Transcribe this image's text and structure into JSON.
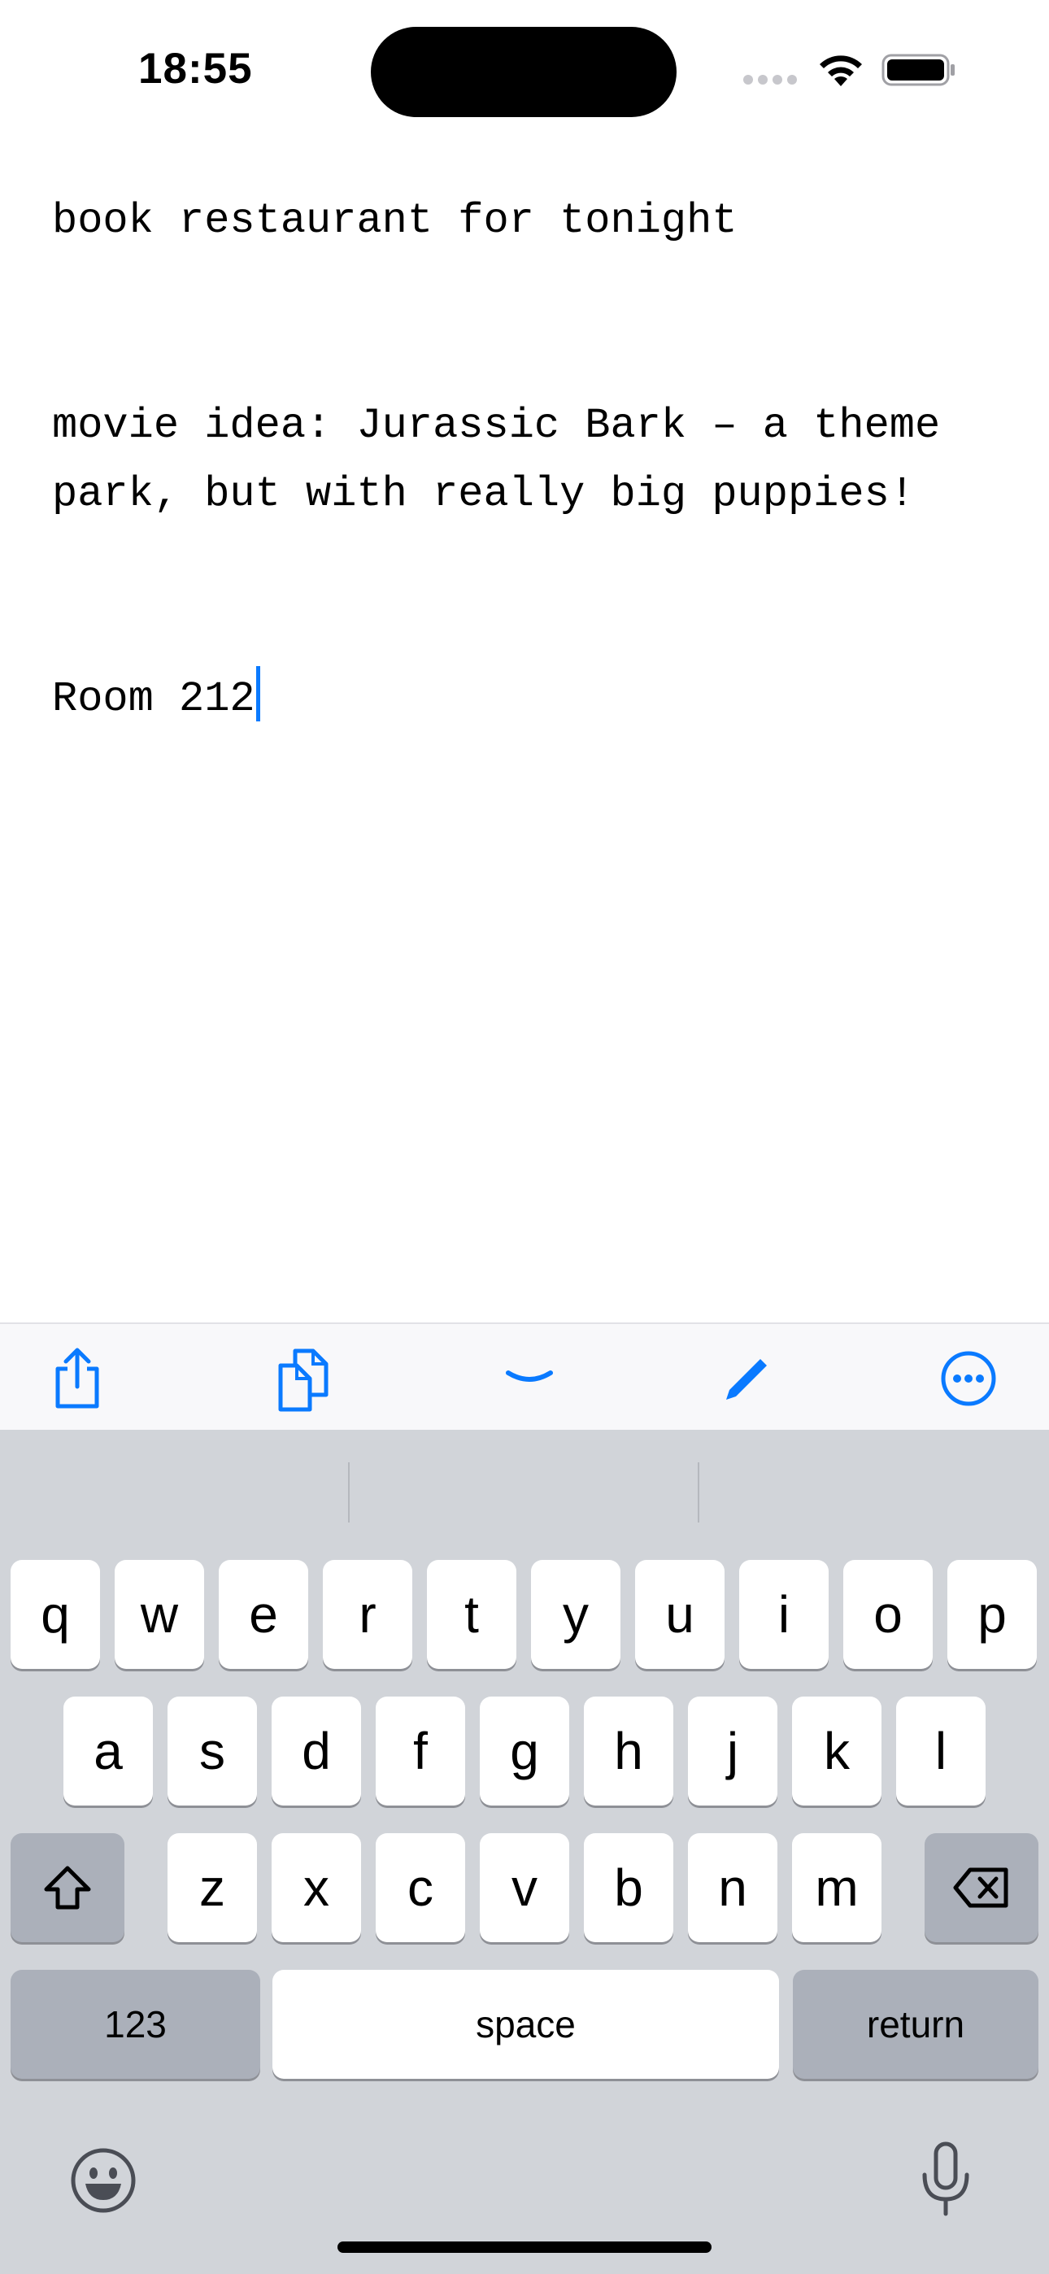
{
  "status_bar": {
    "time": "18:55"
  },
  "note": {
    "lines": [
      "book restaurant for tonight",
      "",
      "",
      "movie idea: Jurassic Bark – a theme",
      "park, but with really big puppies!",
      "",
      "",
      "Room 212"
    ]
  },
  "toolbar": {
    "icons": [
      "share-icon",
      "copy-icon",
      "dismiss-keyboard-icon",
      "pencil-icon",
      "more-icon"
    ],
    "accent_color": "#0a7aff"
  },
  "keyboard": {
    "row1": [
      "q",
      "w",
      "e",
      "r",
      "t",
      "y",
      "u",
      "i",
      "o",
      "p"
    ],
    "row2": [
      "a",
      "s",
      "d",
      "f",
      "g",
      "h",
      "j",
      "k",
      "l"
    ],
    "row3": [
      "z",
      "x",
      "c",
      "v",
      "b",
      "n",
      "m"
    ],
    "numbers_label": "123",
    "space_label": "space",
    "return_label": "return"
  }
}
